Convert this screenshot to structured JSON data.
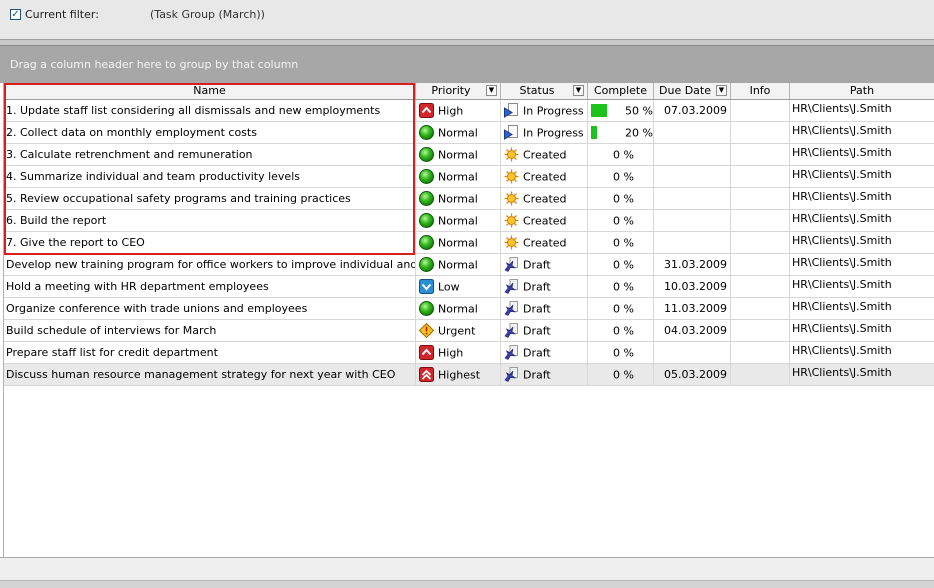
{
  "filter": {
    "checked": true,
    "label": "Current filter:",
    "expression": "(Task Group  (March))"
  },
  "group_hint": "Drag a column header here to group by that column",
  "columns": {
    "name": "Name",
    "priority": "Priority",
    "status": "Status",
    "complete": "Complete",
    "due_date": "Due Date",
    "info": "Info",
    "path": "Path"
  },
  "rows": [
    {
      "name": "1. Update staff list considering all dismissals and new employments",
      "priority": "High",
      "priority_icon": "arrow-up-icon",
      "status": "In Progress",
      "status_icon": "in-progress-icon",
      "complete": "50 %",
      "complete_frac": 0.5,
      "due": "07.03.2009",
      "info": "",
      "path": "HR\\Clients\\J.Smith"
    },
    {
      "name": "2. Collect data on monthly employment costs",
      "priority": "Normal",
      "priority_icon": "green-circle-icon",
      "status": "In Progress",
      "status_icon": "in-progress-icon",
      "complete": "20 %",
      "complete_frac": 0.2,
      "due": "",
      "info": "",
      "path": "HR\\Clients\\J.Smith"
    },
    {
      "name": "3. Calculate retrenchment and remuneration",
      "priority": "Normal",
      "priority_icon": "green-circle-icon",
      "status": "Created",
      "status_icon": "sun-icon",
      "complete": "0 %",
      "complete_frac": 0,
      "due": "",
      "info": "",
      "path": "HR\\Clients\\J.Smith"
    },
    {
      "name": "4. Summarize individual and team productivity levels",
      "priority": "Normal",
      "priority_icon": "green-circle-icon",
      "status": "Created",
      "status_icon": "sun-icon",
      "complete": "0 %",
      "complete_frac": 0,
      "due": "",
      "info": "",
      "path": "HR\\Clients\\J.Smith"
    },
    {
      "name": "5. Review occupational safety programs and training practices",
      "priority": "Normal",
      "priority_icon": "green-circle-icon",
      "status": "Created",
      "status_icon": "sun-icon",
      "complete": "0 %",
      "complete_frac": 0,
      "due": "",
      "info": "",
      "path": "HR\\Clients\\J.Smith"
    },
    {
      "name": "6. Build the report",
      "priority": "Normal",
      "priority_icon": "green-circle-icon",
      "status": "Created",
      "status_icon": "sun-icon",
      "complete": "0 %",
      "complete_frac": 0,
      "due": "",
      "info": "",
      "path": "HR\\Clients\\J.Smith"
    },
    {
      "name": "7. Give the report to CEO",
      "priority": "Normal",
      "priority_icon": "green-circle-icon",
      "status": "Created",
      "status_icon": "sun-icon",
      "complete": "0 %",
      "complete_frac": 0,
      "due": "",
      "info": "",
      "path": "HR\\Clients\\J.Smith"
    },
    {
      "name": "Develop new training program for office workers to improve individual and team",
      "priority": "Normal",
      "priority_icon": "green-circle-icon",
      "status": "Draft",
      "status_icon": "draft-icon",
      "complete": "0 %",
      "complete_frac": 0,
      "due": "31.03.2009",
      "info": "",
      "path": "HR\\Clients\\J.Smith"
    },
    {
      "name": "Hold a meeting with HR department employees",
      "priority": "Low",
      "priority_icon": "arrow-down-icon",
      "status": "Draft",
      "status_icon": "draft-icon",
      "complete": "0 %",
      "complete_frac": 0,
      "due": "10.03.2009",
      "info": "",
      "path": "HR\\Clients\\J.Smith"
    },
    {
      "name": "Organize conference with trade unions and employees",
      "priority": "Normal",
      "priority_icon": "green-circle-icon",
      "status": "Draft",
      "status_icon": "draft-icon",
      "complete": "0 %",
      "complete_frac": 0,
      "due": "11.03.2009",
      "info": "",
      "path": "HR\\Clients\\J.Smith"
    },
    {
      "name": "Build schedule of interviews for March",
      "priority": "Urgent",
      "priority_icon": "warning-icon",
      "status": "Draft",
      "status_icon": "draft-icon",
      "complete": "0 %",
      "complete_frac": 0,
      "due": "04.03.2009",
      "info": "",
      "path": "HR\\Clients\\J.Smith"
    },
    {
      "name": "Prepare staff list for credit department",
      "priority": "High",
      "priority_icon": "arrow-up-icon",
      "status": "Draft",
      "status_icon": "draft-icon",
      "complete": "0 %",
      "complete_frac": 0,
      "due": "",
      "info": "",
      "path": "HR\\Clients\\J.Smith"
    },
    {
      "name": "Discuss human resource management strategy for next year with CEO",
      "priority": "Highest",
      "priority_icon": "double-arrow-up-icon",
      "status": "Draft",
      "status_icon": "draft-icon",
      "complete": "0 %",
      "complete_frac": 0,
      "due": "05.03.2009",
      "info": "",
      "path": "HR\\Clients\\J.Smith"
    }
  ],
  "colors": {
    "highlight": "#d81e1e",
    "progress": "#1dc21d",
    "group_bar": "#a7a7a7"
  }
}
